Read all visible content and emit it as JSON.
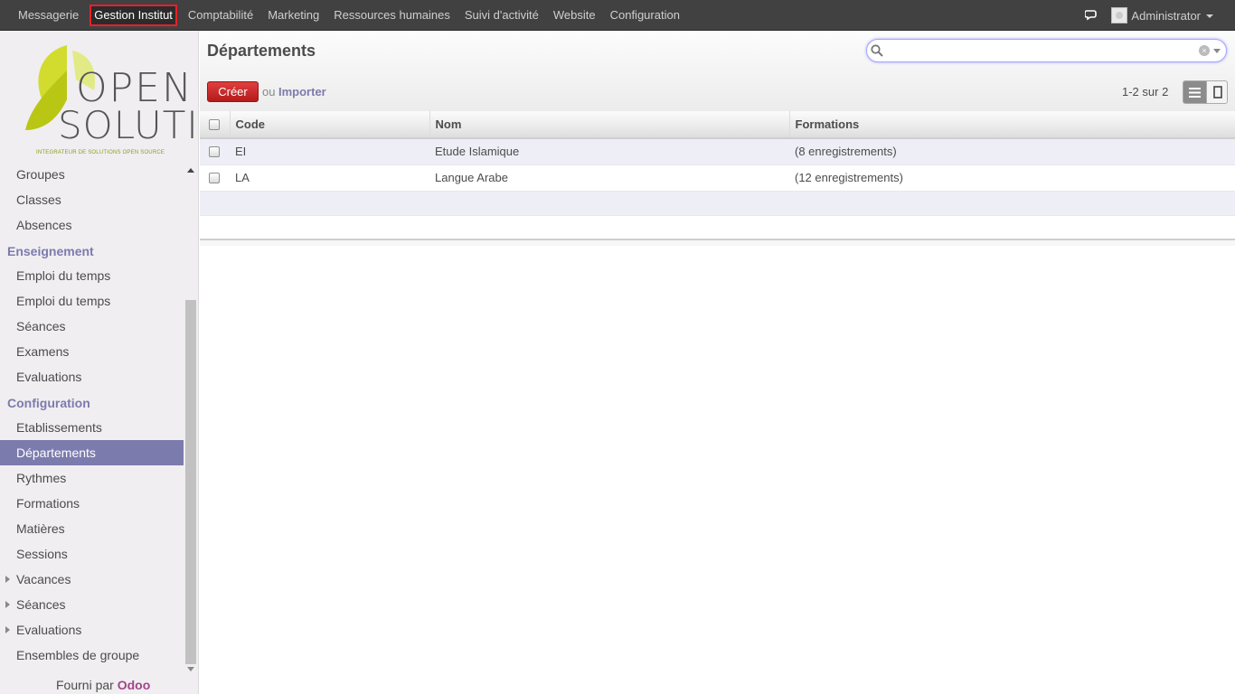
{
  "topbar": {
    "menu": [
      {
        "label": "Messagerie",
        "active": false
      },
      {
        "label": "Gestion Institut",
        "active": true
      },
      {
        "label": "Comptabilité",
        "active": false
      },
      {
        "label": "Marketing",
        "active": false
      },
      {
        "label": "Ressources humaines",
        "active": false
      },
      {
        "label": "Suivi d'activité",
        "active": false
      },
      {
        "label": "Website",
        "active": false
      },
      {
        "label": "Configuration",
        "active": false
      }
    ],
    "user_name": "Administrator"
  },
  "sidebar": {
    "logo": {
      "line1": "OPEN",
      "line2": "SOLUTIS",
      "tagline": "INTEGRATEUR DE SOLUTIONS OPEN SOURCE"
    },
    "items": [
      {
        "label": "Groupes"
      },
      {
        "label": "Classes"
      },
      {
        "label": "Absences"
      },
      {
        "header": "Enseignement"
      },
      {
        "label": "Emploi du temps"
      },
      {
        "label": "Emploi du temps"
      },
      {
        "label": "Séances"
      },
      {
        "label": "Examens"
      },
      {
        "label": "Evaluations"
      },
      {
        "header": "Configuration"
      },
      {
        "label": "Etablissements"
      },
      {
        "label": "Départements",
        "selected": true
      },
      {
        "label": "Rythmes"
      },
      {
        "label": "Formations"
      },
      {
        "label": "Matières"
      },
      {
        "label": "Sessions"
      },
      {
        "label": "Vacances",
        "expandable": true
      },
      {
        "label": "Séances",
        "expandable": true
      },
      {
        "label": "Evaluations",
        "expandable": true
      },
      {
        "label": "Ensembles de groupe"
      }
    ],
    "footer_prefix": "Fourni par",
    "footer_brand": "Odoo"
  },
  "main": {
    "title": "Départements",
    "search_value": "",
    "create_label": "Créer",
    "or_label": "ou",
    "import_label": "Importer",
    "pager": "1-2 sur 2",
    "columns": [
      "Code",
      "Nom",
      "Formations"
    ],
    "rows": [
      {
        "code": "EI",
        "nom": "Etude Islamique",
        "formations": "(8 enregistrements)"
      },
      {
        "code": "LA",
        "nom": "Langue Arabe",
        "formations": "(12 enregistrements)"
      }
    ]
  },
  "colors": {
    "accent": "#7c7bad",
    "create": "#c12a2a",
    "active_border": "#e8202a",
    "odoo": "#a24689"
  }
}
